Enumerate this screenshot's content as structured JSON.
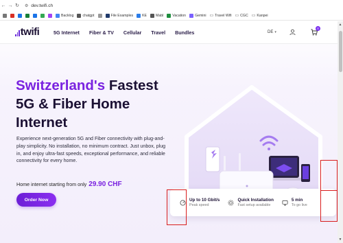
{
  "browser": {
    "url": "dev.twifi.ch",
    "bookmarks": [
      "Backlog",
      "chatgpt",
      "File Examples",
      "KE",
      "Mabl",
      "Vacation",
      "Gemini",
      "Travel Wifi",
      "CGC",
      "Kanpei"
    ]
  },
  "header": {
    "logo_text": "twifi",
    "menu": [
      {
        "label": "5G Internet"
      },
      {
        "label": "Fiber & TV"
      },
      {
        "label": "Cellular"
      },
      {
        "label": "Travel"
      },
      {
        "label": "Bundles"
      }
    ],
    "lang": "DE",
    "cart_count": "0"
  },
  "hero": {
    "title_accent": "Switzerland's",
    "title_rest_1": " Fastest",
    "title_line_2": "5G & Fiber Home",
    "title_line_3": "Internet",
    "description": "Experience next-generation 5G and Fiber connectivity with plug-and-play simplicity. No installation, no minimum contract. Just unbox, plug in, and enjoy ultra-fast speeds, exceptional performance, and reliable connectivity for every home.",
    "price_prefix": "Home internet starting from only",
    "price": "29.90 CHF",
    "cta": "Order Now"
  },
  "features": [
    {
      "title": "Up to 10 Gbit/s",
      "sub": "Peak speed",
      "icon": "speed-icon"
    },
    {
      "title": "Quick Installation",
      "sub": "Fast setup available",
      "icon": "gear-icon"
    },
    {
      "title": "5 min",
      "sub": "To go live",
      "icon": "monitor-icon"
    }
  ],
  "colors": {
    "accent": "#7a22e0",
    "annotation": "#d81c1c"
  }
}
